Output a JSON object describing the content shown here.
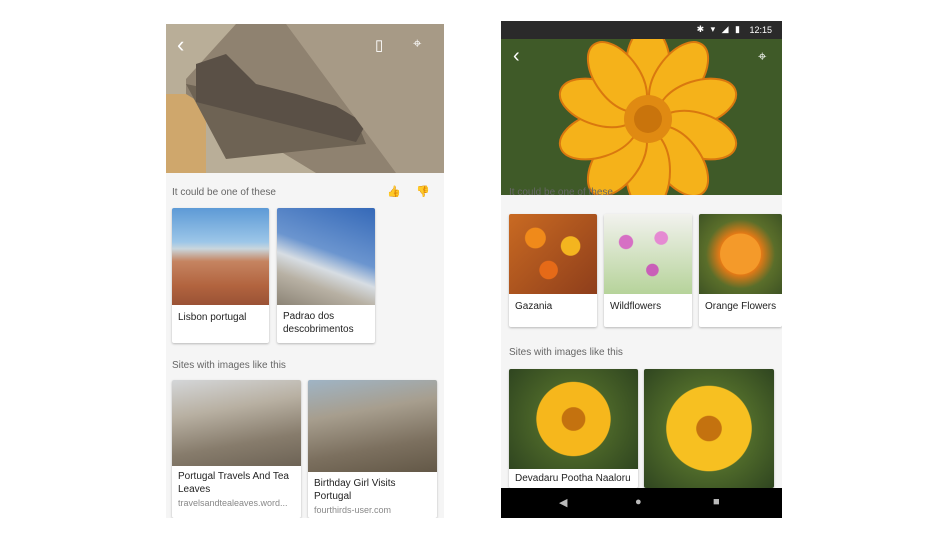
{
  "left_phone": {
    "section1_title": "It could be one of these",
    "thumbs_up_icon": "👍",
    "thumbs_down_icon": "👎",
    "back_icon": "‹",
    "bookmark_icon": "▯",
    "lens_icon": "⌖",
    "matches": [
      {
        "label": "Lisbon portugal"
      },
      {
        "label": "Padrao dos descobrimentos"
      }
    ],
    "section2_title": "Sites with images like this",
    "sites": [
      {
        "title": "Portugal Travels And Tea Leaves",
        "url": "travelsandtealeaves.word..."
      },
      {
        "title": "Birthday Girl Visits Portugal",
        "url": "fourthirds-user.com"
      }
    ]
  },
  "right_phone": {
    "status": {
      "time": "12:15",
      "icons": "✱ ▾ ◢ ▮"
    },
    "back_icon": "‹",
    "lens_icon": "⌖",
    "section1_title": "It could be one of these",
    "matches": [
      {
        "label": "Gazania"
      },
      {
        "label": "Wildflowers"
      },
      {
        "label": "Orange Flowers"
      }
    ],
    "section2_title": "Sites with images like this",
    "sites": [
      {
        "title": "Devadaru Pootha Naaloru"
      },
      {
        "title": ""
      }
    ],
    "nav": {
      "back": "◀",
      "home": "●",
      "recents": "■"
    }
  },
  "colors": {
    "accent_flower": "#f2a012",
    "panel_bg": "#f5f5f5",
    "nav_bg": "#000000"
  }
}
